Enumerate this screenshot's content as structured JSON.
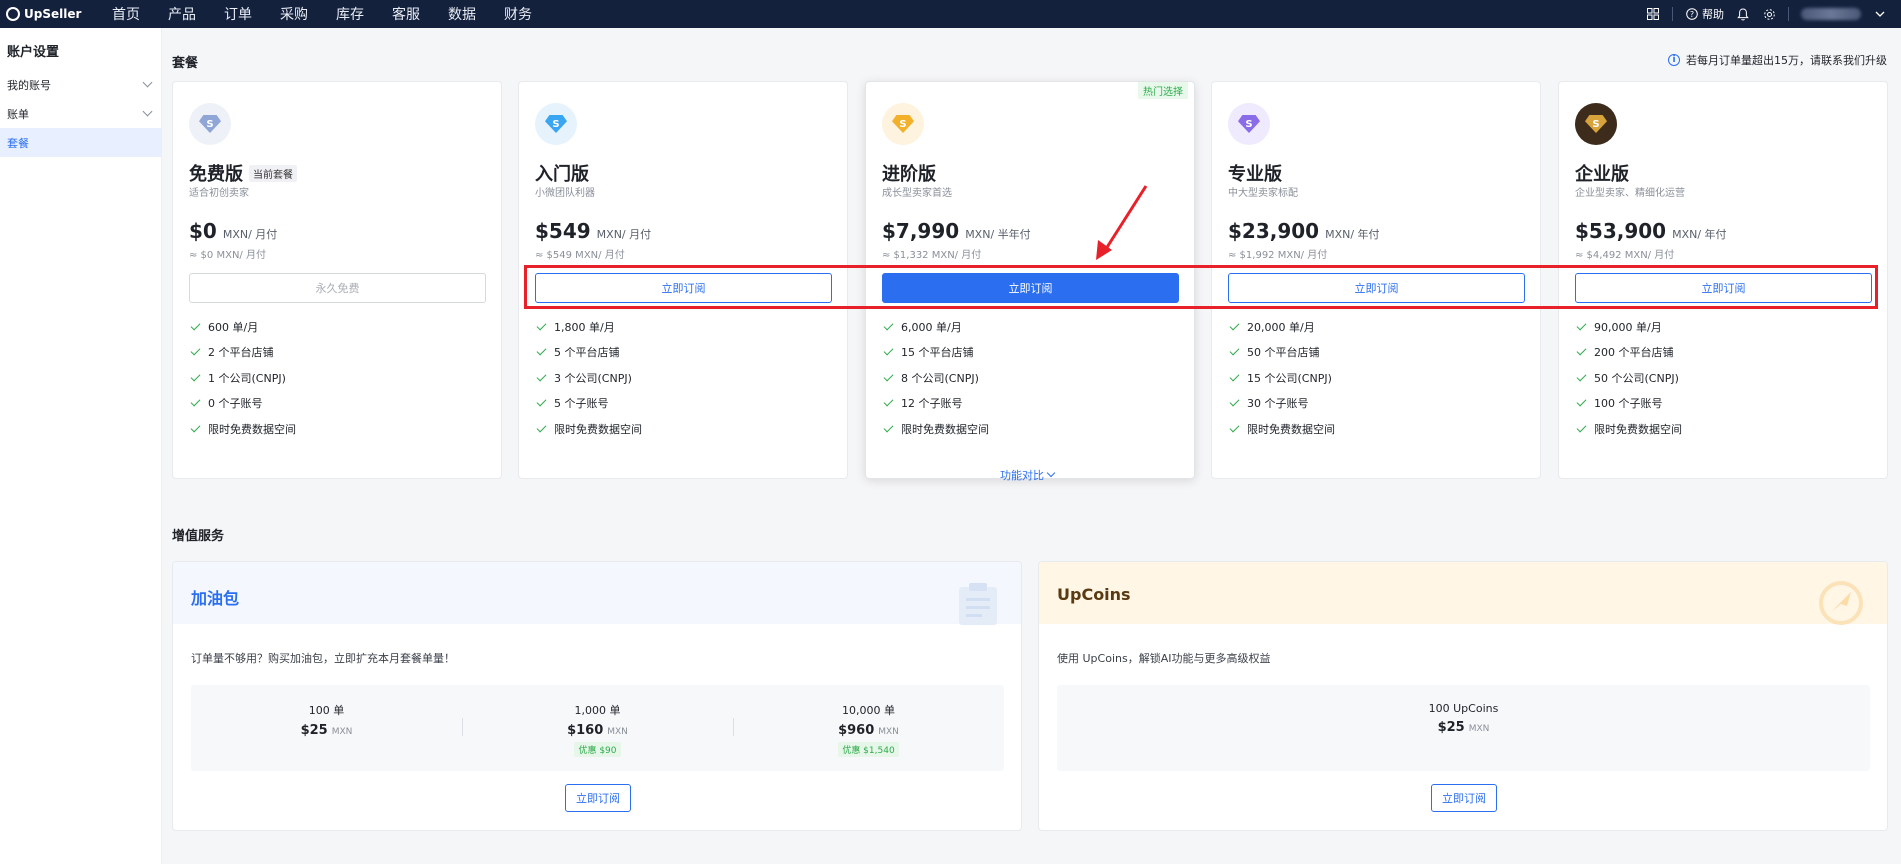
{
  "topbar": {
    "brand": "UpSeller",
    "nav": [
      "首页",
      "产品",
      "订单",
      "采购",
      "库存",
      "客服",
      "数据",
      "财务"
    ],
    "help_label": "帮助",
    "icons": [
      "apps-grid-icon",
      "help-circle-icon",
      "bell-icon",
      "gear-icon",
      "chevron-down-icon"
    ]
  },
  "sidebar": {
    "title": "账户设置",
    "items": [
      {
        "label": "我的账号",
        "expandable": true
      },
      {
        "label": "账单",
        "expandable": true
      },
      {
        "label": "套餐",
        "active": true
      }
    ]
  },
  "plans_section": {
    "title": "套餐",
    "notice": "若每月订单量超出15万，请联系我们升级",
    "compare_label": "功能对比",
    "plans": [
      {
        "name": "免费版",
        "badge": "当前套餐",
        "desc": "适合初创卖家",
        "price": "$0",
        "unit": "MXN/ 月付",
        "sub": "≈ $0 MXN/ 月付",
        "button": "永久免费",
        "button_style": "disabled",
        "icon_color": "#8fa6d6",
        "icon_bg": "#eef1f7",
        "features": [
          "600 单/月",
          "2 个平台店铺",
          "1 个公司(CNPJ)",
          "0 个子账号",
          "限时免费数据空间"
        ]
      },
      {
        "name": "入门版",
        "desc": "小微团队利器",
        "price": "$549",
        "unit": "MXN/ 月付",
        "sub": "≈ $549 MXN/ 月付",
        "button": "立即订阅",
        "button_style": "outline",
        "icon_color": "#3aa5f0",
        "icon_bg": "#e6f3fd",
        "features": [
          "1,800 单/月",
          "5 个平台店铺",
          "3 个公司(CNPJ)",
          "5 个子账号",
          "限时免费数据空间"
        ]
      },
      {
        "name": "进阶版",
        "hot": "热门选择",
        "desc": "成长型卖家首选",
        "price": "$7,990",
        "unit": "MXN/ 半年付",
        "sub": "≈ $1,332 MXN/ 月付",
        "button": "立即订阅",
        "button_style": "primary",
        "icon_color": "#f3b12b",
        "icon_bg": "#fdf3df",
        "features": [
          "6,000 单/月",
          "15 个平台店铺",
          "8 个公司(CNPJ)",
          "12 个子账号",
          "限时免费数据空间"
        ]
      },
      {
        "name": "专业版",
        "desc": "中大型卖家标配",
        "price": "$23,900",
        "unit": "MXN/ 年付",
        "sub": "≈ $1,992 MXN/ 月付",
        "button": "立即订阅",
        "button_style": "outline",
        "icon_color": "#8a6be8",
        "icon_bg": "#efeafd",
        "features": [
          "20,000 单/月",
          "50 个平台店铺",
          "15 个公司(CNPJ)",
          "30 个子账号",
          "限时免费数据空间"
        ]
      },
      {
        "name": "企业版",
        "desc": "企业型卖家、精细化运营",
        "price": "$53,900",
        "unit": "MXN/ 年付",
        "sub": "≈ $4,492 MXN/ 月付",
        "button": "立即订阅",
        "button_style": "outline",
        "icon_color": "#d9a33c",
        "icon_bg": "#3d2c1c",
        "features": [
          "90,000 单/月",
          "200 个平台店铺",
          "50 个公司(CNPJ)",
          "100 个子账号",
          "限时免费数据空间"
        ]
      }
    ]
  },
  "value_added": {
    "title": "增值服务",
    "fuel": {
      "title": "加油包",
      "title_color": "#2b6ff0",
      "header_bg": "#f4f8fe",
      "desc": "订单量不够用？购买加油包，立即扩充本月套餐单量！",
      "options": [
        {
          "qty": "100 单",
          "price": "$25",
          "currency": "MXN"
        },
        {
          "qty": "1,000 单",
          "price": "$160",
          "currency": "MXN",
          "discount": "优惠 $90"
        },
        {
          "qty": "10,000 单",
          "price": "$960",
          "currency": "MXN",
          "discount": "优惠 $1,540"
        }
      ],
      "button": "立即订阅"
    },
    "coins": {
      "title": "UpCoins",
      "title_color": "#5a3a12",
      "header_bg": "#fff6e6",
      "desc": "使用 UpCoins，解锁AI功能与更多高级权益",
      "options": [
        {
          "qty": "100 UpCoins",
          "price": "$25",
          "currency": "MXN"
        }
      ],
      "button": "立即订阅"
    }
  },
  "annotation_colors": {
    "highlight": "#e8202a"
  }
}
